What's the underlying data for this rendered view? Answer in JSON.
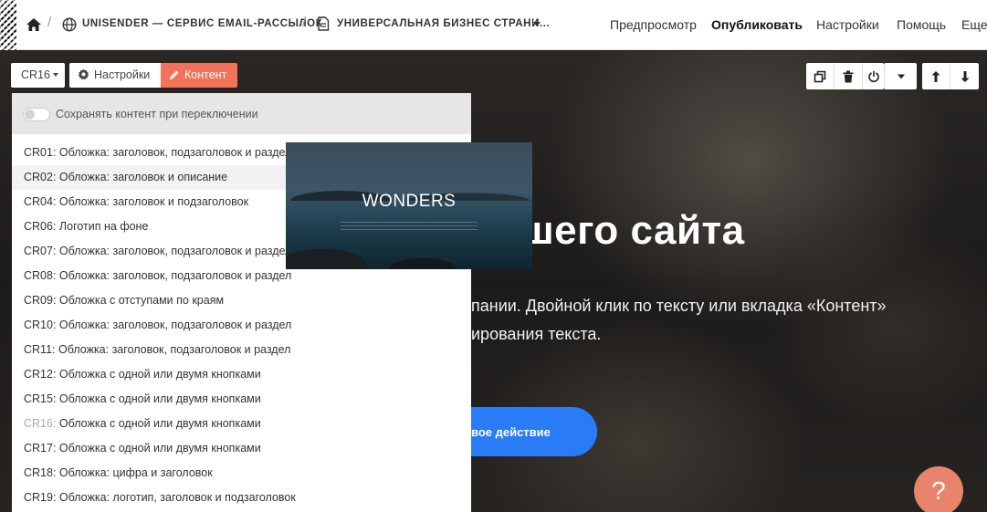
{
  "topbar": {
    "breadcrumb_site": "UNISENDER — СЕРВИС EMAIL-РАССЫЛОК",
    "breadcrumb_page": "УНИВЕРСАЛЬНАЯ БИЗНЕС СТРАНИ...",
    "nav": {
      "preview": "Предпросмотр",
      "publish": "Опубликовать",
      "settings": "Настройки",
      "help": "Помощь",
      "more": "Еще"
    }
  },
  "toolbar": {
    "block_code": "CR16",
    "settings_label": "Настройки",
    "content_label": "Контент"
  },
  "panel": {
    "toggle_label": "Сохранять контент при переключении",
    "items": [
      {
        "code": "CR01:",
        "label": "Обложка: заголовок, подзаголовок и раздел"
      },
      {
        "code": "CR02:",
        "label": "Обложка: заголовок и описание"
      },
      {
        "code": "CR04:",
        "label": "Обложка: заголовок и подзаголовок"
      },
      {
        "code": "CR06:",
        "label": "Логотип на фоне"
      },
      {
        "code": "CR07:",
        "label": "Обложка: заголовок, подзаголовок и раздел"
      },
      {
        "code": "CR08:",
        "label": "Обложка: заголовок, подзаголовок и раздел"
      },
      {
        "code": "CR09:",
        "label": "Обложка с отступами по краям"
      },
      {
        "code": "CR10:",
        "label": "Обложка: заголовок, подзаголовок и раздел"
      },
      {
        "code": "CR11:",
        "label": "Обложка: заголовок, подзаголовок и раздел"
      },
      {
        "code": "CR12:",
        "label": "Обложка с одной или двумя кнопками"
      },
      {
        "code": "CR15:",
        "label": "Обложка с одной или двумя кнопками"
      },
      {
        "code": "CR16:",
        "label": "Обложка с одной или двумя кнопками"
      },
      {
        "code": "CR17:",
        "label": "Обложка с одной или двумя кнопками"
      },
      {
        "code": "CR18:",
        "label": "Обложка: цифра и заголовок"
      },
      {
        "code": "CR19:",
        "label": "Обложка: логотип, заголовок и подзаголовок"
      }
    ],
    "preview_title": "WONDERS"
  },
  "hero": {
    "title": "шего сайта",
    "text": "пании. Двойной клик по тексту или вкладка «Контент» ирования текста.",
    "cta": "вое действие"
  },
  "help_button": "?",
  "colors": {
    "accent": "#f2725a",
    "cta_blue": "#2a7bf6",
    "help": "#e8846c"
  }
}
